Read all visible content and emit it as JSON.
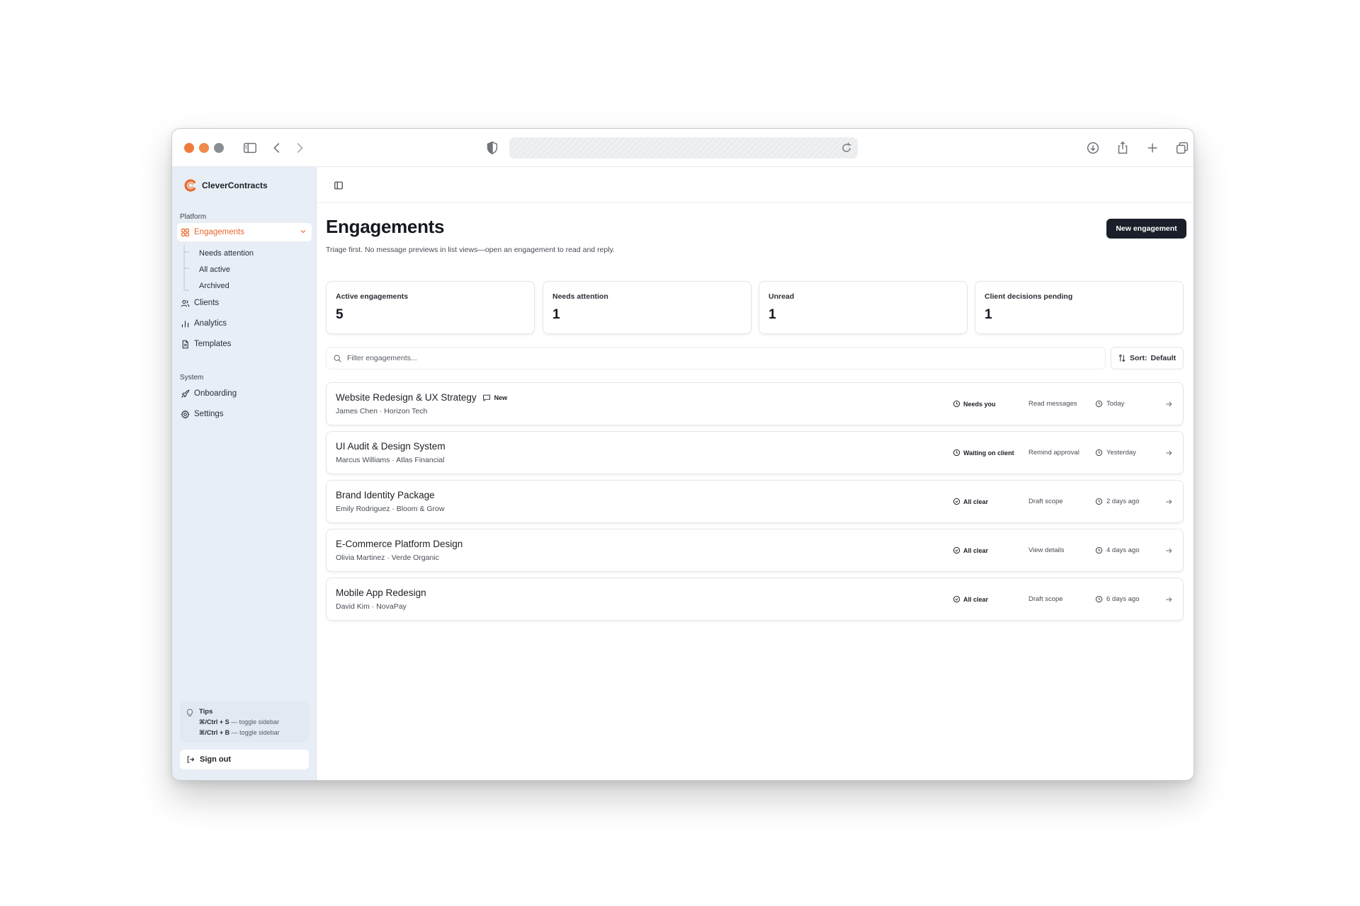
{
  "browser": {
    "traffic_lights": [
      "#ef7a3e",
      "#ef8a4a",
      "#8a8d92"
    ]
  },
  "sidebar": {
    "brand": "CleverContracts",
    "brand_color": "#e8672a",
    "platform_label": "Platform",
    "system_label": "System",
    "platform_items": [
      {
        "label": "Engagements",
        "icon": "grid-icon",
        "active": true
      },
      {
        "label": "Clients",
        "icon": "users-icon"
      },
      {
        "label": "Analytics",
        "icon": "bar-chart-icon"
      },
      {
        "label": "Templates",
        "icon": "file-icon"
      }
    ],
    "sub_items": [
      "Needs attention",
      "All active",
      "Archived"
    ],
    "system_items": [
      {
        "label": "Onboarding",
        "icon": "rocket-icon"
      },
      {
        "label": "Settings",
        "icon": "gear-icon"
      }
    ],
    "tips": {
      "title": "Tips",
      "lines": [
        {
          "keys": "⌘/Ctrl + S",
          "desc": " — toggle sidebar"
        },
        {
          "keys": "⌘/Ctrl + B",
          "desc": " — toggle sidebar"
        }
      ]
    },
    "sign_out": "Sign out"
  },
  "main": {
    "title": "Engagements",
    "subtitle": "Triage first. No message previews in list views—open an engagement to read and reply.",
    "new_button": "New engagement",
    "stats": [
      {
        "label": "Active engagements",
        "value": "5"
      },
      {
        "label": "Needs attention",
        "value": "1"
      },
      {
        "label": "Unread",
        "value": "1"
      },
      {
        "label": "Client decisions pending",
        "value": "1"
      }
    ],
    "filter_placeholder": "Filter engagements...",
    "sort_label": "Sort:",
    "sort_value": "Default",
    "rows": [
      {
        "title": "Website Redesign & UX Strategy",
        "new": "New",
        "client": "James Chen · Horizon Tech",
        "status": "Needs you",
        "action": "Read messages",
        "time": "Today"
      },
      {
        "title": "UI Audit & Design System",
        "client": "Marcus Williams · Atlas Financial",
        "status": "Waiting on client",
        "action": "Remind approval",
        "time": "Yesterday"
      },
      {
        "title": "Brand Identity Package",
        "client": "Emily Rodriguez · Bloom & Grow",
        "status": "All clear",
        "action": "Draft scope",
        "time": "2 days ago"
      },
      {
        "title": "E-Commerce Platform Design",
        "client": "Olivia Martinez · Verde Organic",
        "status": "All clear",
        "action": "View details",
        "time": "4 days ago"
      },
      {
        "title": "Mobile App Redesign",
        "client": "David Kim · NovaPay",
        "status": "All clear",
        "action": "Draft scope",
        "time": "6 days ago"
      }
    ]
  }
}
